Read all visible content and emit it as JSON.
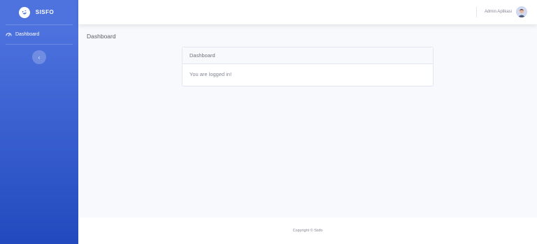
{
  "brand": {
    "name": "SISFO",
    "icon": "laugh-wink-icon"
  },
  "sidebar": {
    "items": [
      {
        "label": "Dashboard",
        "icon": "dashboard-icon"
      }
    ],
    "toggle_glyph": "‹"
  },
  "topbar": {
    "user_name": "Admin Aplikasi"
  },
  "page": {
    "title": "Dashboard"
  },
  "card": {
    "header": "Dashboard",
    "body": "You are logged in!"
  },
  "footer": {
    "copyright": "Copyright © Sisfo"
  },
  "colors": {
    "primary": "#4e73df",
    "primary_dark": "#224abe",
    "background": "#f8f9fc"
  }
}
